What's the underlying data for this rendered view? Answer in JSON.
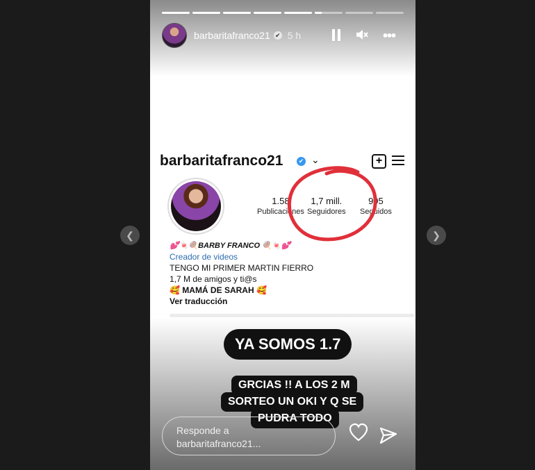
{
  "story": {
    "progress": {
      "segments": 8,
      "completed": 5,
      "current_fraction": 0.25
    },
    "header": {
      "username": "barbaritafranco21",
      "time": "5 h"
    }
  },
  "profile": {
    "username": "barbaritafranco21",
    "stats": [
      {
        "value": "1.58",
        "label": "Publicaciones"
      },
      {
        "value": "1,7 mill.",
        "label": "Seguidores"
      },
      {
        "value": "995",
        "label": "Seguidos"
      }
    ],
    "bio": {
      "name": "💕🍬🍭BARBY FRANCO 🍭🍬💕",
      "role": "Creador de videos",
      "line1": "TENGO MI PRIMER MARTIN FIERRO",
      "line2": "1,7 M de amigos y ti@s",
      "line3": "🥰 MAMÁ DE SARAH 🥰",
      "translate": "Ver traducción"
    }
  },
  "captions": {
    "main": "YA SOMOS 1.7",
    "line1": "GRCIAS !! A LOS 2 M",
    "line2": "SORTEO UN OKI Y Q SE",
    "line3": "PUDRA TODO"
  },
  "reply": {
    "placeholder_line1": "Responde a",
    "placeholder_line2": "barbaritafranco21..."
  },
  "colors": {
    "verified": "#3897f0",
    "annotation": "#e0303a",
    "link": "#2b6cb0"
  }
}
